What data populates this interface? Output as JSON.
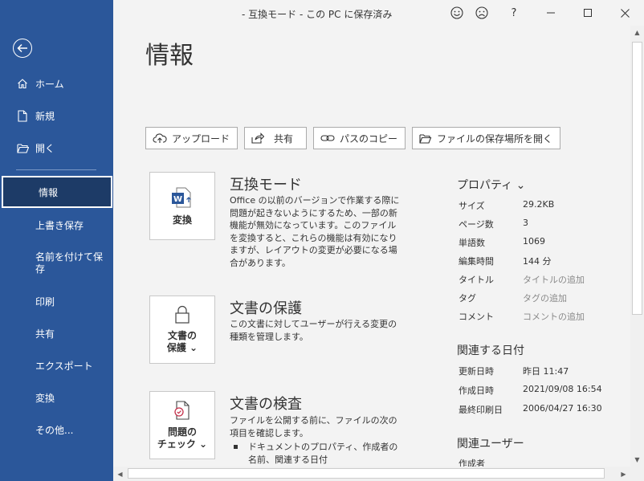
{
  "window": {
    "title": "-  互換モード - この PC に保存済み",
    "buttons": [
      "smile-icon",
      "frown-icon",
      "help-icon",
      "minimize-icon",
      "maximize-icon",
      "close-icon"
    ],
    "help_label": "?"
  },
  "sidebar": {
    "home": "ホーム",
    "new": "新規",
    "open": "開く",
    "info": "情報",
    "save": "上書き保存",
    "save_as": "名前を付けて保存",
    "print": "印刷",
    "share": "共有",
    "export": "エクスポート",
    "convert": "変換",
    "more": "その他..."
  },
  "main": {
    "title": "情報",
    "toolbar": {
      "upload": "アップロード",
      "share": "共有",
      "copy_path": "パスのコピー",
      "open_location": "ファイルの保存場所を開く"
    },
    "sections": {
      "compat": {
        "card_label": "変換",
        "title": "互換モード",
        "body": "Office の以前のバージョンで作業する際に問題が起きないようにするため、一部の新機能が無効になっています。このファイルを変換すると、これらの機能は有効になりますが、レイアウトの変更が必要になる場合があります。"
      },
      "protect": {
        "card_label_1": "文書の",
        "card_label_2": "保護 ⌄",
        "title": "文書の保護",
        "body": "この文書に対してユーザーが行える変更の種類を管理します。"
      },
      "inspect": {
        "card_label_1": "問題の",
        "card_label_2": "チェック ⌄",
        "title": "文書の検査",
        "body": "ファイルを公開する前に、ファイルの次の項目を確認します。",
        "bullet": "ドキュメントのプロパティ、作成者の名前、関連する日付"
      }
    },
    "properties": {
      "heading": "プロパティ ⌄",
      "size_k": "サイズ",
      "size_v": "29.2KB",
      "pages_k": "ページ数",
      "pages_v": "3",
      "words_k": "単語数",
      "words_v": "1069",
      "edit_k": "編集時間",
      "edit_v": "144 分",
      "title_k": "タイトル",
      "title_v": "タイトルの追加",
      "tags_k": "タグ",
      "tags_v": "タグの追加",
      "comment_k": "コメント",
      "comment_v": "コメントの追加"
    },
    "dates": {
      "heading": "関連する日付",
      "modified_k": "更新日時",
      "modified_v": "昨日 11:47",
      "created_k": "作成日時",
      "created_v": "2021/09/08 16:54",
      "printed_k": "最終印刷日",
      "printed_v": "2006/04/27 16:30"
    },
    "people": {
      "heading": "関連ユーザー",
      "author_k": "作成者"
    }
  },
  "colors": {
    "sidebar": "#2b579a",
    "sidebar_selected": "#1d3b67",
    "word_blue": "#2b579a"
  }
}
